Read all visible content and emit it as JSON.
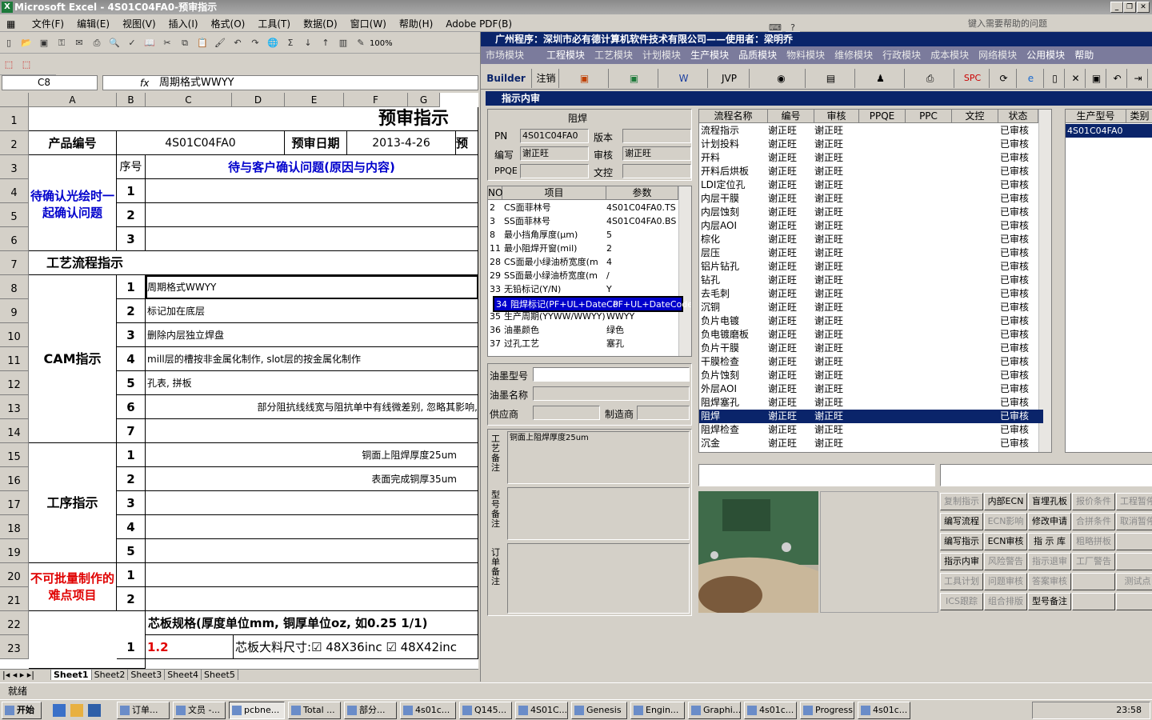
{
  "excel": {
    "title": "Microsoft Excel - 4S01C04FA0-预审指示",
    "menu": [
      "文件(F)",
      "编辑(E)",
      "视图(V)",
      "插入(I)",
      "格式(O)",
      "工具(T)",
      "数据(D)",
      "窗口(W)",
      "帮助(H)",
      "Adobe PDF(B)"
    ],
    "help_placeholder": "键入需要帮助的问题",
    "namebox": "C8",
    "formula": "周期格式WWYY",
    "zoom": "100%",
    "columns": [
      "A",
      "B",
      "C",
      "D",
      "E",
      "F",
      "G"
    ],
    "rows": [
      "1",
      "2",
      "3",
      "4",
      "5",
      "6",
      "7",
      "8",
      "9",
      "10",
      "11",
      "12",
      "13",
      "14",
      "15",
      "16",
      "17",
      "18",
      "19",
      "20",
      "21",
      "22",
      "23"
    ],
    "sheet_title": "预审指示",
    "product_label": "产品编号",
    "product_value": "4S01C04FA0",
    "date_label": "预审日期",
    "date_value": "2013-4-26",
    "date_more": "预",
    "seq_label": "序号",
    "issue_header": "待与客户确认问题(原因与内容)",
    "pending_label": "待确认光绘时一起确认问题",
    "process_label": "工艺流程指示",
    "cam_label": "CAM指示",
    "proc_label": "工序指示",
    "hard_label": "不可批量制作的难点项目",
    "core_label": "芯板规格(厚度单位mm, 铜厚单位oz, 如0.25 1/1)",
    "nums": [
      "1",
      "2",
      "3",
      "1",
      "2",
      "3",
      "4",
      "5",
      "6",
      "7",
      "1",
      "2",
      "3",
      "4",
      "5",
      "1",
      "2",
      "1"
    ],
    "cam_items": [
      "周期格式WWYY",
      "标记加在底层",
      "删除内层独立焊盘",
      "mill层的槽按非金属化制作, slot层的按金属化制作",
      "孔表, 拼板",
      "部分阻抗线线宽与阻抗单中有线微差别, 忽略其影响,",
      ""
    ],
    "proc_items": [
      "铜面上阻焊厚度25um",
      "表面完成铜厚35um"
    ],
    "core_val": "1.2",
    "core_size": "芯板大料尺寸:☑ 48X36inc ☑ 48X42inc",
    "sheets": [
      "Sheet1",
      "Sheet2",
      "Sheet3",
      "Sheet4",
      "Sheet5"
    ],
    "status": "就绪"
  },
  "app": {
    "title": "广州程序：深圳市必有德计算机软件技术有限公司——使用者：梁明乔",
    "menu": [
      "市场模块",
      "工程模块",
      "工艺模块",
      "计划模块",
      "生产模块",
      "品质模块",
      "物料模块",
      "维修模块",
      "行政模块",
      "成本模块",
      "网络模块",
      "公用模块",
      "帮助"
    ],
    "toolbar": [
      "Builder",
      "注销",
      "JVP",
      "SPC"
    ],
    "subwindow_title": "指示内审",
    "section_title": "阻焊",
    "pn_label": "PN",
    "pn_value": "4S01C04FA0",
    "version_label": "版本",
    "version_value": "",
    "writer_label": "编写",
    "writer_value": "谢正旺",
    "audit_label": "审核",
    "audit_value": "谢正旺",
    "ppqe_label": "PPQE",
    "ppqe_value": "",
    "doc_label": "文控",
    "doc_value": "",
    "param_headers": [
      "NO",
      "项目",
      "参数"
    ],
    "params": [
      [
        "2",
        "CS面菲林号",
        "4S01C04FA0.TS"
      ],
      [
        "3",
        "SS面菲林号",
        "4S01C04FA0.BS"
      ],
      [
        "8",
        "最小挡角厚度(μm)",
        "5"
      ],
      [
        "11",
        "最小阻焊开窗(mil)",
        "2"
      ],
      [
        "28",
        "CS面最小绿油桥宽度(m",
        "4"
      ],
      [
        "29",
        "SS面最小绿油桥宽度(m",
        "/"
      ],
      [
        "33",
        "无铅标记(Y/N)",
        "Y"
      ],
      [
        "34",
        "阻焊标记(PF+UL+DateCo",
        "PF+UL+DateCode"
      ],
      [
        "35",
        "生产周期(YYWW/WWYY)",
        "WWYY"
      ],
      [
        "36",
        "油墨颜色",
        "绿色"
      ],
      [
        "37",
        "过孔工艺",
        "塞孔"
      ]
    ],
    "ink_model_label": "油墨型号",
    "ink_name_label": "油墨名称",
    "supplier_label": "供应商",
    "maker_label": "制造商",
    "craft_note_label": "工艺备注",
    "craft_note_value": "铜面上阻焊厚度25um",
    "model_note_label": "型号备注",
    "order_note_label": "订单备注",
    "flow_headers": [
      "流程名称",
      "编号",
      "审核",
      "PPQE",
      "PPC",
      "文控",
      "状态"
    ],
    "flows": [
      [
        "流程指示",
        "谢正旺",
        "谢正旺",
        "已审核"
      ],
      [
        "计划投料",
        "谢正旺",
        "谢正旺",
        "已审核"
      ],
      [
        "开料",
        "谢正旺",
        "谢正旺",
        "已审核"
      ],
      [
        "开料后烘板",
        "谢正旺",
        "谢正旺",
        "已审核"
      ],
      [
        "LDI定位孔",
        "谢正旺",
        "谢正旺",
        "已审核"
      ],
      [
        "内层干膜",
        "谢正旺",
        "谢正旺",
        "已审核"
      ],
      [
        "内层蚀刻",
        "谢正旺",
        "谢正旺",
        "已审核"
      ],
      [
        "内层AOI",
        "谢正旺",
        "谢正旺",
        "已审核"
      ],
      [
        "棕化",
        "谢正旺",
        "谢正旺",
        "已审核"
      ],
      [
        "层压",
        "谢正旺",
        "谢正旺",
        "已审核"
      ],
      [
        "铝片钻孔",
        "谢正旺",
        "谢正旺",
        "已审核"
      ],
      [
        "钻孔",
        "谢正旺",
        "谢正旺",
        "已审核"
      ],
      [
        "去毛刺",
        "谢正旺",
        "谢正旺",
        "已审核"
      ],
      [
        "沉铜",
        "谢正旺",
        "谢正旺",
        "已审核"
      ],
      [
        "负片电镀",
        "谢正旺",
        "谢正旺",
        "已审核"
      ],
      [
        "负电镀磨板",
        "谢正旺",
        "谢正旺",
        "已审核"
      ],
      [
        "负片干膜",
        "谢正旺",
        "谢正旺",
        "已审核"
      ],
      [
        "干膜检查",
        "谢正旺",
        "谢正旺",
        "已审核"
      ],
      [
        "负片蚀刻",
        "谢正旺",
        "谢正旺",
        "已审核"
      ],
      [
        "外层AOI",
        "谢正旺",
        "谢正旺",
        "已审核"
      ],
      [
        "阻焊塞孔",
        "谢正旺",
        "谢正旺",
        "已审核"
      ],
      [
        "阻焊",
        "谢正旺",
        "谢正旺",
        "已审核"
      ],
      [
        "阻焊检查",
        "谢正旺",
        "谢正旺",
        "已审核"
      ],
      [
        "沉金",
        "谢正旺",
        "谢正旺",
        "已审核"
      ]
    ],
    "selected_flow": 21,
    "model_headers": [
      "生产型号",
      "类别"
    ],
    "model_value": "4S01C04FA0",
    "buttons": [
      [
        "复制指示",
        "内部ECN",
        "盲埋孔板",
        "报价条件",
        "工程暂停"
      ],
      [
        "编写流程",
        "ECN影响",
        "修改申请",
        "合拼条件",
        "取消暂停"
      ],
      [
        "编写指示",
        "ECN审核",
        "指 示 库",
        "粗略拼板",
        ""
      ],
      [
        "指示内审",
        "风险警告",
        "指示退审",
        "工厂警告",
        ""
      ],
      [
        "工具计划",
        "问题审核",
        "答案审核",
        "",
        "测试点"
      ],
      [
        "ICS跟踪",
        "组合排版",
        "型号备注",
        "",
        ""
      ]
    ],
    "disabled_buttons": [
      "复制指示",
      "报价条件",
      "工程暂停",
      "ECN影响",
      "合拼条件",
      "取消暂停",
      "粗略拼板",
      "风险警告",
      "指示退审",
      "工厂警告",
      "工具计划",
      "问题审核",
      "答案审核",
      "测试点",
      "ICS跟踪",
      "组合排版"
    ]
  },
  "taskbar": {
    "start": "开始",
    "tasks": [
      "订单...",
      "文员 -...",
      "pcbne...",
      "Total ...",
      "部分...",
      "4s01c...",
      "Q145...",
      "4S01C...",
      "Genesis",
      "Engin...",
      "Graphi...",
      "4s01c...",
      "Progress",
      "4s01c..."
    ],
    "clock": "23:58"
  },
  "colors": {
    "titlebar": "#0a246a",
    "selection": "#0a246a",
    "blue_text": "#0000cc",
    "red_text": "#e00000"
  }
}
